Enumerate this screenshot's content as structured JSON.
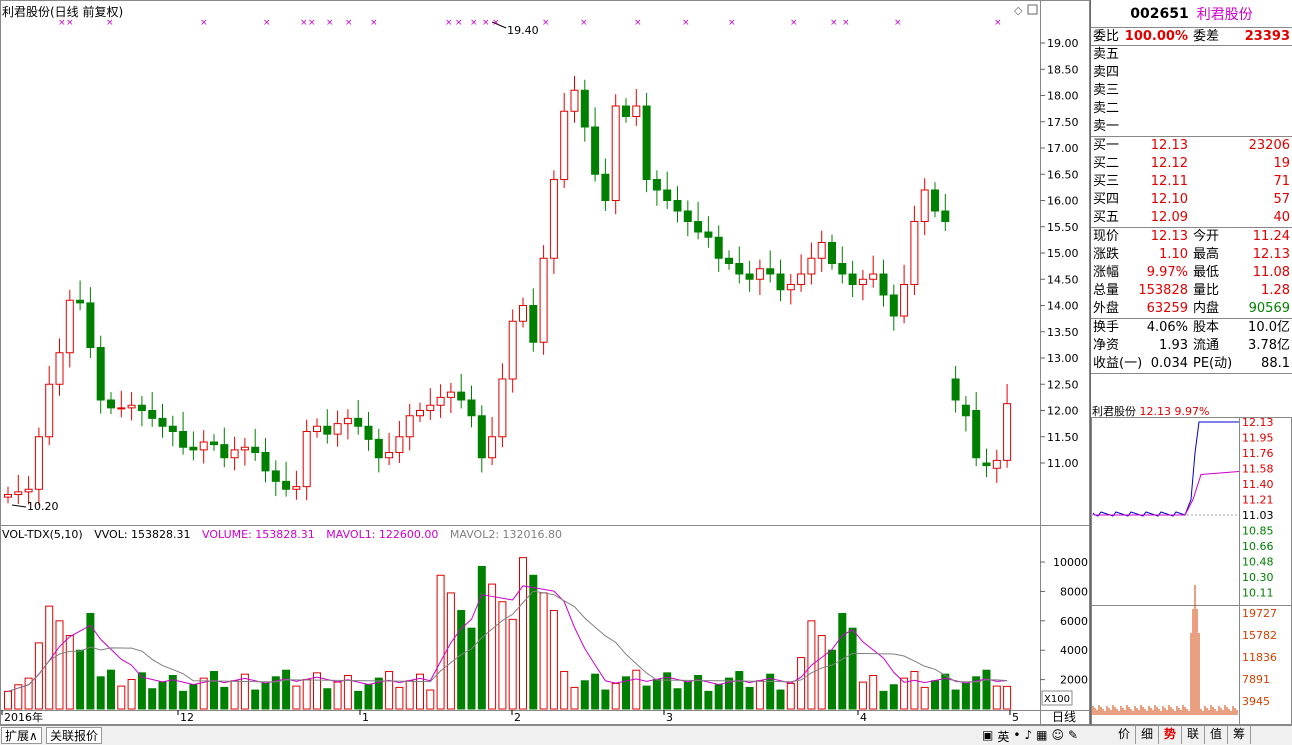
{
  "title": "利君股份(日线 前复权)",
  "price_axis": [
    "19.00",
    "18.50",
    "18.00",
    "17.50",
    "17.00",
    "16.50",
    "16.00",
    "15.50",
    "15.00",
    "14.50",
    "14.00",
    "13.50",
    "13.00",
    "12.50",
    "12.00",
    "11.50",
    "11.00"
  ],
  "annotations": {
    "high": "19.40",
    "low": "10.20"
  },
  "vol_title": {
    "name": "VOL-TDX(5,10)",
    "vvol": "VVOL: 153828.31",
    "volume": "VOLUME: 153828.31",
    "mavol1": "MAVOL1: 122600.00",
    "mavol2": "MAVOL2: 132016.80"
  },
  "vol_axis": [
    "10000",
    "8000",
    "6000",
    "4000",
    "2000"
  ],
  "vol_unit": "X100",
  "period_label": "日线",
  "date_axis": [
    "2016年",
    "12",
    "1",
    "2",
    "3",
    "4",
    "5"
  ],
  "bottom_tabs": [
    "扩展∧",
    "关联报价"
  ],
  "quote": {
    "code": "002651",
    "name": "利君股份",
    "weibi_label": "委比",
    "weibi": "100.00%",
    "weicha_label": "委差",
    "weicha": "23393",
    "sell": [
      {
        "label": "卖五"
      },
      {
        "label": "卖四"
      },
      {
        "label": "卖三"
      },
      {
        "label": "卖二"
      },
      {
        "label": "卖一"
      }
    ],
    "buy": [
      {
        "label": "买一",
        "price": "12.13",
        "vol": "23206"
      },
      {
        "label": "买二",
        "price": "12.12",
        "vol": "19"
      },
      {
        "label": "买三",
        "price": "12.11",
        "vol": "71"
      },
      {
        "label": "买四",
        "price": "12.10",
        "vol": "57"
      },
      {
        "label": "买五",
        "price": "12.09",
        "vol": "40"
      }
    ],
    "stats": [
      {
        "l1": "现价",
        "v1": "12.13",
        "l2": "今开",
        "v2": "11.24"
      },
      {
        "l1": "涨跌",
        "v1": "1.10",
        "l2": "最高",
        "v2": "12.13"
      },
      {
        "l1": "涨幅",
        "v1": "9.97%",
        "l2": "最低",
        "v2": "11.08"
      },
      {
        "l1": "总量",
        "v1": "153828",
        "l2": "量比",
        "v2": "1.28"
      },
      {
        "l1": "外盘",
        "v1": "63259",
        "l2": "内盘",
        "v2": "90569"
      }
    ],
    "fund": [
      {
        "l1": "换手",
        "v1": "4.06%",
        "l2": "股本",
        "v2": "10.0亿"
      },
      {
        "l1": "净资",
        "v1": "1.93",
        "l2": "流通",
        "v2": "3.78亿"
      },
      {
        "l1": "收益(一)",
        "v1": "0.034",
        "l2": "PE(动)",
        "v2": "88.1"
      }
    ]
  },
  "mini": {
    "title_name": "利君股份",
    "title_price": "12.13",
    "title_pct": "9.97%",
    "price_axis": [
      "12.13",
      "11.95",
      "11.76",
      "11.58",
      "11.40",
      "11.21",
      "11.03",
      "10.85",
      "10.66",
      "10.48",
      "10.30",
      "10.11"
    ],
    "vol_axis": [
      "19727",
      "15782",
      "11836",
      "7891",
      "3945"
    ]
  },
  "sidebar_tabs": [
    "价",
    "细",
    "势",
    "联",
    "值",
    "筹"
  ],
  "colors": {
    "up": "#e00000",
    "down": "#008000",
    "ma1": "#cc00cc",
    "ma2": "#808080"
  },
  "chart_data": {
    "type": "candlestick",
    "title": "利君股份(日线 前复权)",
    "ohlc_approx": [
      [
        10.3,
        10.45,
        10.25,
        10.4
      ],
      [
        10.4,
        10.42,
        10.2,
        10.35
      ],
      [
        10.35,
        10.45,
        10.3,
        10.42
      ],
      [
        10.42,
        10.55,
        10.4,
        10.5
      ],
      [
        10.5,
        11.6,
        10.5,
        11.55
      ],
      [
        11.55,
        12.8,
        11.5,
        12.7
      ],
      [
        12.7,
        13.3,
        12.65,
        13.1
      ],
      [
        13.1,
        14.2,
        13.0,
        14.1
      ],
      [
        14.1,
        15.2,
        13.9,
        14.05
      ],
      [
        13.85,
        13.9,
        13.1,
        13.15
      ],
      [
        12.4,
        12.5,
        12.1,
        12.2
      ],
      [
        12.2,
        12.3,
        11.95,
        12.05
      ],
      [
        11.95,
        12.1,
        11.85,
        12.0
      ],
      [
        12.0,
        12.25,
        11.95,
        12.2
      ],
      [
        12.2,
        12.25,
        12.0,
        12.05
      ],
      [
        11.9,
        12.0,
        11.7,
        11.85
      ],
      [
        11.85,
        11.95,
        11.65,
        11.7
      ],
      [
        11.85,
        11.9,
        11.6,
        11.65
      ],
      [
        11.55,
        11.6,
        11.2,
        11.3
      ],
      [
        11.2,
        11.3,
        11.1,
        11.25
      ],
      [
        11.25,
        11.45,
        11.15,
        11.4
      ],
      [
        11.4,
        11.55,
        11.3,
        11.35
      ],
      [
        11.0,
        11.2,
        10.85,
        11.1
      ],
      [
        11.1,
        11.3,
        11.0,
        11.25
      ],
      [
        11.25,
        11.35,
        11.1,
        11.3
      ],
      [
        11.45,
        11.55,
        11.1,
        11.2
      ],
      [
        11.2,
        11.3,
        10.8,
        10.85
      ],
      [
        10.55,
        10.8,
        10.4,
        10.65
      ],
      [
        10.65,
        10.7,
        10.35,
        10.45
      ],
      [
        10.45,
        10.7,
        10.35,
        10.6
      ]
    ]
  }
}
